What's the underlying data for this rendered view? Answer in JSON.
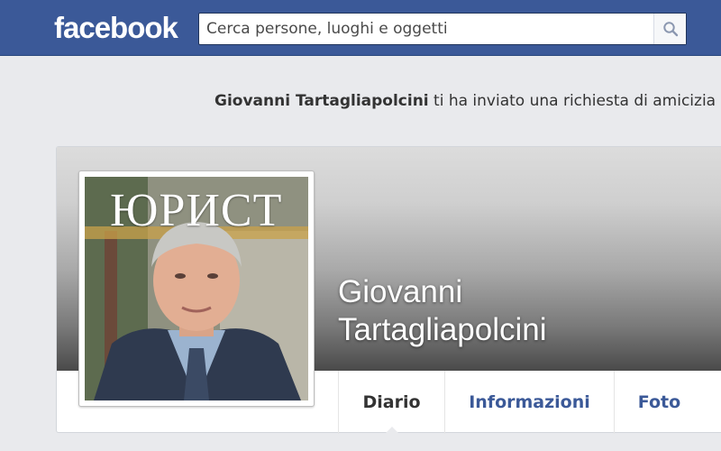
{
  "header": {
    "logo": "facebook",
    "search_placeholder": "Cerca persone, luoghi e oggetti",
    "search_icon": "magnifier-icon",
    "brand_color": "#3b5998"
  },
  "notice": {
    "sender": "Giovanni Tartagliapolcini",
    "text": " ti ha inviato una richiesta di amicizia"
  },
  "profile": {
    "name_line1": "Giovanni",
    "name_line2": "Tartagliapolcini",
    "photo_masthead": "ЮРИСТ",
    "tabs": [
      {
        "label": "Diario",
        "active": true
      },
      {
        "label": "Informazioni",
        "active": false
      },
      {
        "label": "Foto",
        "active": false
      }
    ]
  }
}
